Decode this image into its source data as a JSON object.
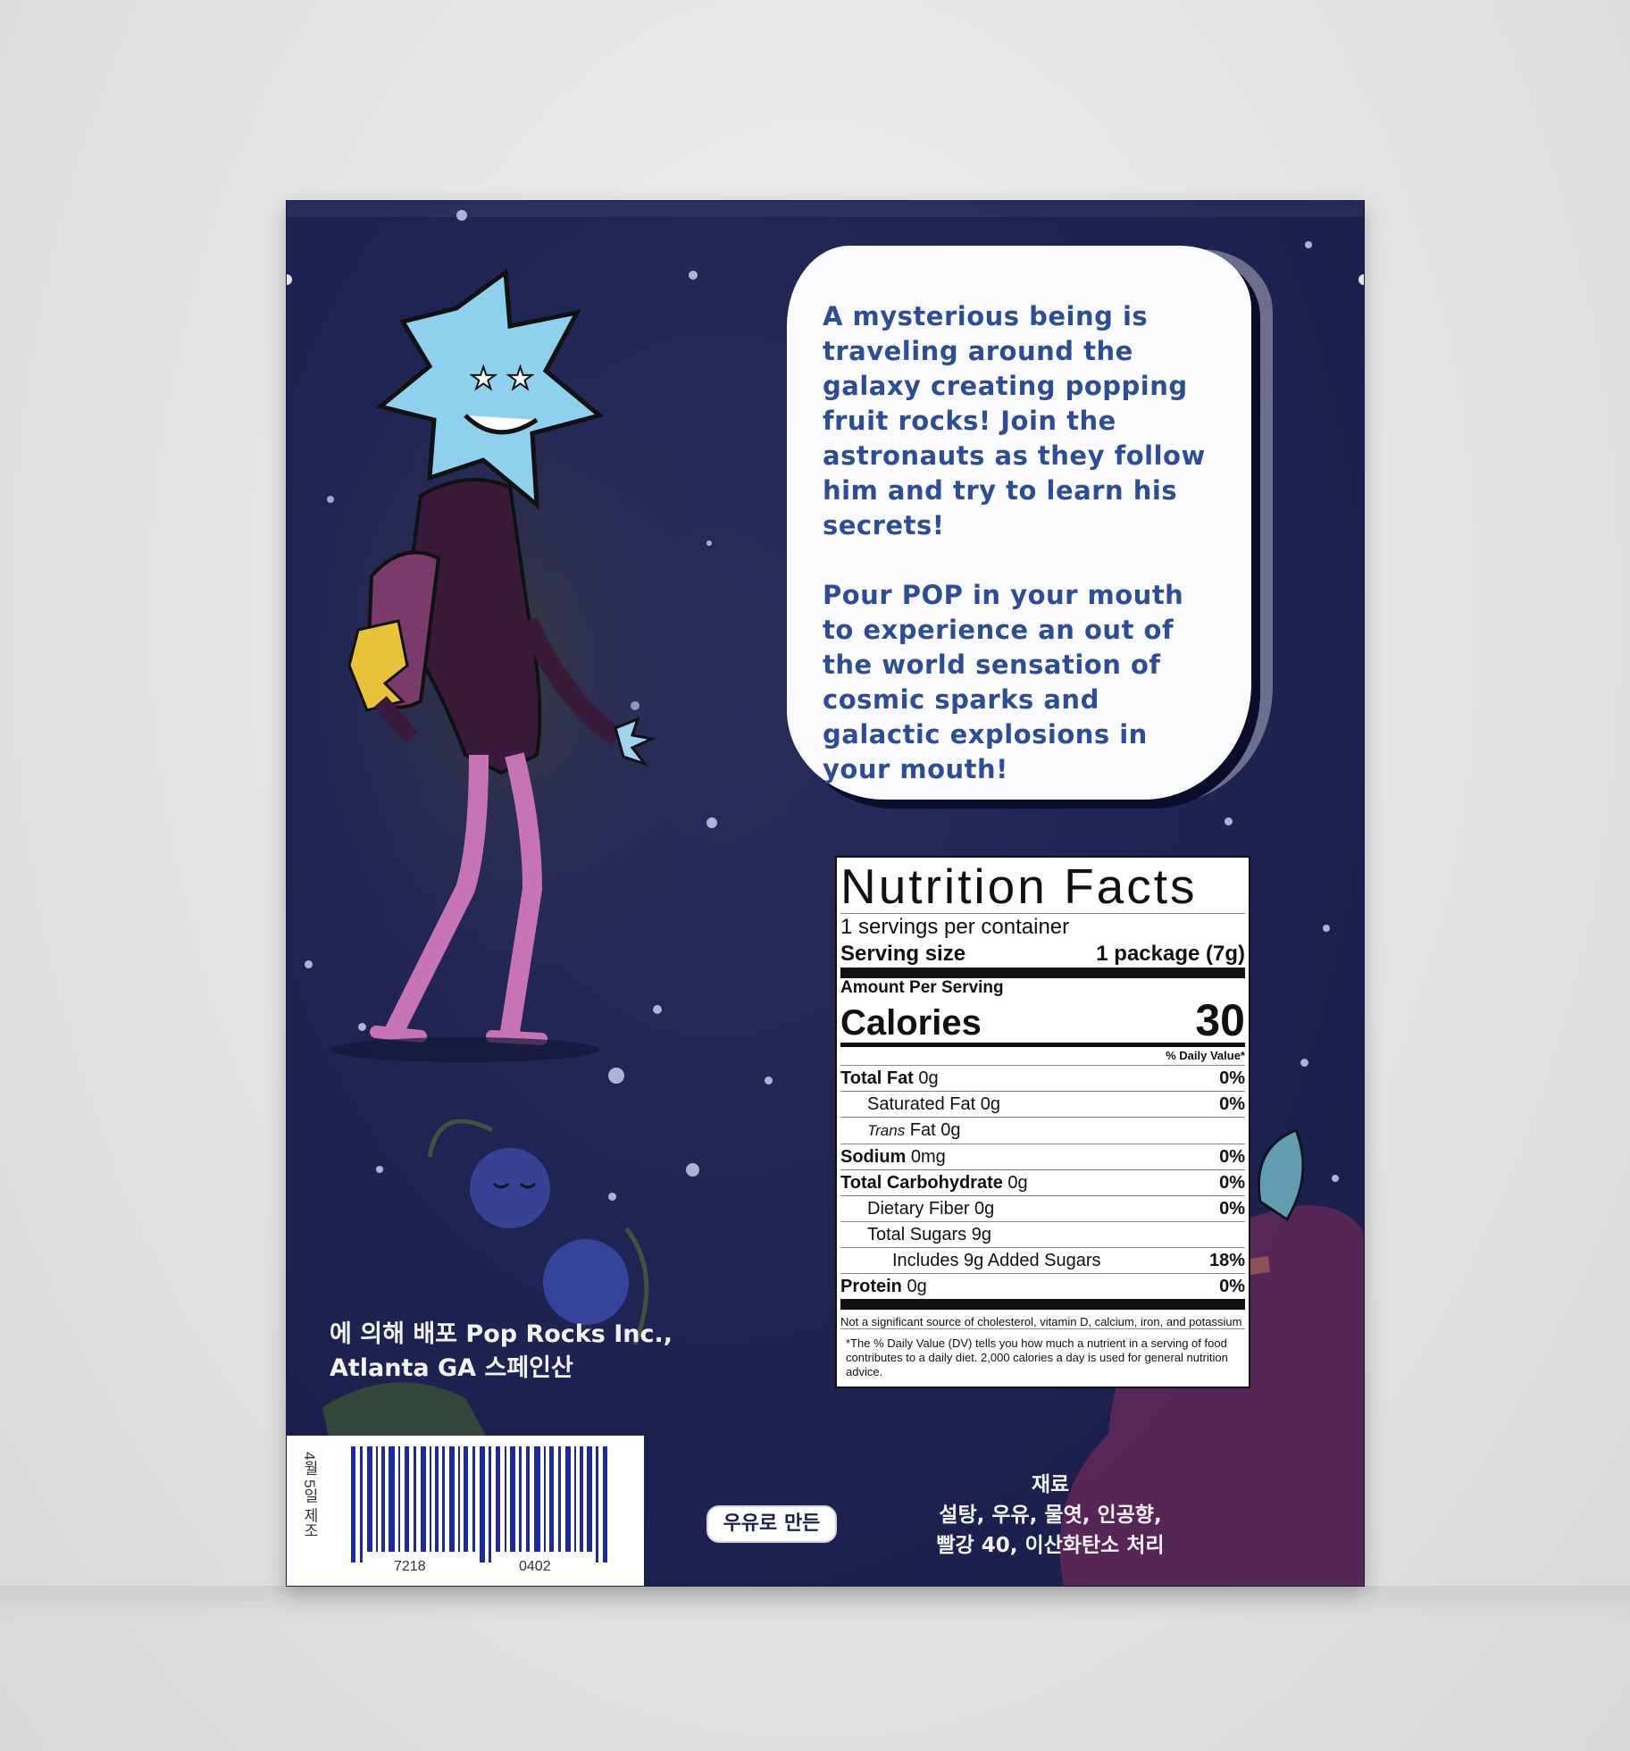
{
  "story": {
    "paragraph1": "A mysterious being is traveling around the galaxy creating popping fruit rocks! Join the astronauts as they follow him and try to learn his secrets!",
    "paragraph2": "Pour POP in your mouth to experience an out of the world sensation of cosmic sparks and galactic explosions in your mouth!"
  },
  "nutrition": {
    "title": "Nutrition Facts",
    "servings": "1 servings per container",
    "serving_size_label": "Serving size",
    "serving_size_value": "1 package (7g)",
    "amount_per_serving": "Amount Per Serving",
    "calories_label": "Calories",
    "calories_value": "30",
    "dv_header": "% Daily Value*",
    "rows": [
      {
        "bold": "Total Fat",
        "amount": " 0g",
        "dv": "0%"
      },
      {
        "label": "Saturated Fat 0g",
        "dv": "0%"
      },
      {
        "italic": "Trans",
        "amount": " Fat 0g",
        "dv": ""
      },
      {
        "bold": "Sodium",
        "amount": " 0mg",
        "dv": "0%"
      },
      {
        "bold": "Total Carbohydrate",
        "amount": " 0g",
        "dv": "0%"
      },
      {
        "label": "Dietary Fiber 0g",
        "dv": "0%"
      },
      {
        "label": "Total Sugars 9g",
        "dv": ""
      },
      {
        "label": "Includes 9g Added Sugars",
        "dv": "18%"
      },
      {
        "bold": "Protein",
        "amount": " 0g",
        "dv": "0%"
      }
    ],
    "note": "Not a significant source of cholesterol, vitamin D, calcium, iron, and potassium",
    "footnote": "*The % Daily Value (DV) tells you how much a nutrient in a serving of food contributes to a daily diet. 2,000 calories a day is used for general nutrition advice."
  },
  "distributor": {
    "line1": "에 의해 배포 Pop Rocks Inc.,",
    "line2": "Atlanta GA 스페인산"
  },
  "barcode": {
    "date": "4월 5일 제조",
    "num_left": "7218",
    "num_right": "0402"
  },
  "milk_badge": "우유로 만든",
  "ingredients": {
    "title": "재료",
    "line1": "설탕, 우유, 물엿, 인공향,",
    "line2": "빨강 40, 이산화탄소 처리"
  },
  "colors": {
    "bag": "#202454",
    "cloud_text": "#2d4e96",
    "character_head": "#8fd0ef",
    "suit": "#3a1a3a",
    "limb_pink": "#c774b5"
  }
}
